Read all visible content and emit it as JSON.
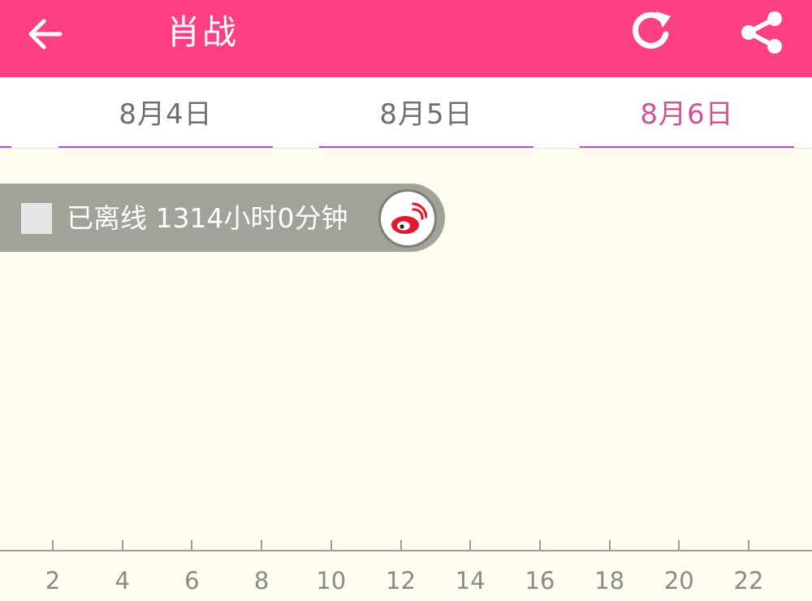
{
  "header": {
    "title": "肖战",
    "background": "#fd4083"
  },
  "tabs": [
    {
      "label": "8月4日",
      "active": false
    },
    {
      "label": "8月5日",
      "active": false
    },
    {
      "label": "8月6日",
      "active": true
    }
  ],
  "status": {
    "text": "已离线 1314小时0分钟",
    "icon": "weibo-icon"
  },
  "timeline": {
    "ticks": [
      "2",
      "4",
      "6",
      "8",
      "10",
      "12",
      "14",
      "16",
      "18",
      "20",
      "22"
    ]
  },
  "colors": {
    "accent": "#fd4083",
    "tab_active_text": "#d0529a",
    "tab_underline": "#c24cd8",
    "content_bg": "#fffdef",
    "status_pill": "#a2a29a"
  }
}
